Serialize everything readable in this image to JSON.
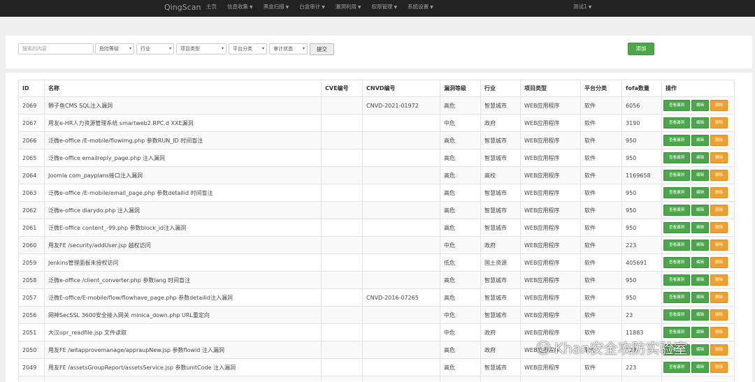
{
  "navbar": {
    "brand": "QingScan",
    "items": [
      {
        "label": "主页",
        "dropdown": false
      },
      {
        "label": "信息收集",
        "dropdown": true
      },
      {
        "label": "黑盒扫描",
        "dropdown": true
      },
      {
        "label": "白盒审计",
        "dropdown": true
      },
      {
        "label": "漏洞利用",
        "dropdown": true
      },
      {
        "label": "权限管理",
        "dropdown": true
      },
      {
        "label": "系统设置",
        "dropdown": true
      }
    ],
    "user": "测试1"
  },
  "filters": {
    "search_placeholder": "搜索的内容",
    "risk_level": "危险等级",
    "industry": "行业",
    "project_type": "项目类型",
    "platform": "平台分类",
    "audit_status": "审计状态",
    "submit_label": "提交",
    "add_label": "添加"
  },
  "table": {
    "headers": [
      "ID",
      "名称",
      "CVE编号",
      "CNVD编号",
      "漏洞等级",
      "行业",
      "项目类型",
      "平台分类",
      "fofa数量",
      "操作"
    ],
    "action_labels": {
      "view": "查看漏洞",
      "edit": "编辑",
      "delete": "删除"
    },
    "rows": [
      {
        "id": "2069",
        "name": "狮子鱼CMS SQL注入漏洞",
        "cve": "",
        "cnvd": "CNVD-2021-01972",
        "level": "高危",
        "industry": "智慧城市",
        "type": "WEB应用程序",
        "platform": "软件",
        "fofa": "6056"
      },
      {
        "id": "2067",
        "name": "用友e-HR人力资源管理系统 smartweb2.RPC.d XXE漏洞",
        "cve": "",
        "cnvd": "",
        "level": "中危",
        "industry": "政府",
        "type": "WEB应用程序",
        "platform": "软件",
        "fofa": "3190"
      },
      {
        "id": "2066",
        "name": "泛微e-office /E-mobile/flowimg.php 参数RUN_ID 时间盲注",
        "cve": "",
        "cnvd": "",
        "level": "高危",
        "industry": "智慧城市",
        "type": "WEB应用程序",
        "platform": "软件",
        "fofa": "950"
      },
      {
        "id": "2065",
        "name": "泛微e-office emailreply_page.php 注入漏洞",
        "cve": "",
        "cnvd": "",
        "level": "高危",
        "industry": "智慧城市",
        "type": "WEB应用程序",
        "platform": "软件",
        "fofa": "950"
      },
      {
        "id": "2064",
        "name": "Joomla com_payplans接口注入漏洞",
        "cve": "",
        "cnvd": "",
        "level": "高危",
        "industry": "高校",
        "type": "WEB应用程序",
        "platform": "软件",
        "fofa": "1169658"
      },
      {
        "id": "2063",
        "name": "泛微e-office /E-mobile/email_page.php 参数detailid 时间盲注",
        "cve": "",
        "cnvd": "",
        "level": "高危",
        "industry": "智慧城市",
        "type": "WEB应用程序",
        "platform": "软件",
        "fofa": "950"
      },
      {
        "id": "2062",
        "name": "泛微e-office diarydo.php 注入漏洞",
        "cve": "",
        "cnvd": "",
        "level": "高危",
        "industry": "智慧城市",
        "type": "WEB应用程序",
        "platform": "软件",
        "fofa": "950"
      },
      {
        "id": "2061",
        "name": "泛微E-office content_-99.php 参数block_id注入漏洞",
        "cve": "",
        "cnvd": "",
        "level": "高危",
        "industry": "智慧城市",
        "type": "WEB应用程序",
        "platform": "软件",
        "fofa": "950"
      },
      {
        "id": "2060",
        "name": "用友FE /security/addUser.jsp 越权访问",
        "cve": "",
        "cnvd": "",
        "level": "中危",
        "industry": "政府",
        "type": "WEB应用程序",
        "platform": "软件",
        "fofa": "223"
      },
      {
        "id": "2059",
        "name": "Jenkins管理面板未授权访问",
        "cve": "",
        "cnvd": "",
        "level": "低危",
        "industry": "国土资源",
        "type": "WEB应用程序",
        "platform": "软件",
        "fofa": "405691"
      },
      {
        "id": "2058",
        "name": "泛微e-office /client_converter.php 参数lang 时间盲注",
        "cve": "",
        "cnvd": "",
        "level": "高危",
        "industry": "智慧城市",
        "type": "WEB应用程序",
        "platform": "软件",
        "fofa": "950"
      },
      {
        "id": "2057",
        "name": "泛微E-office/E-mobile/flow/flowhave_page.php 参数detailid注入漏洞",
        "cve": "",
        "cnvd": "CNVD-2016-07265",
        "level": "高危",
        "industry": "智慧城市",
        "type": "WEB应用程序",
        "platform": "软件",
        "fofa": "950"
      },
      {
        "id": "2056",
        "name": "网神SecSSL 3600安全接入网关 minica_down.php URL重定向",
        "cve": "",
        "cnvd": "",
        "level": "中危",
        "industry": "智慧城市",
        "type": "WEB应用程序",
        "platform": "软件",
        "fofa": "23"
      },
      {
        "id": "2051",
        "name": "大汉opr_readfile.jsp 文件读取",
        "cve": "",
        "cnvd": "",
        "level": "中危",
        "industry": "政府",
        "type": "WEB应用程序",
        "platform": "软件",
        "fofa": "11883"
      },
      {
        "id": "2050",
        "name": "用友FE /witapprovemanage/appraupNew.jsp 参数flowid 注入漏洞",
        "cve": "",
        "cnvd": "",
        "level": "高危",
        "industry": "政府",
        "type": "WEB应用程序",
        "platform": "软件",
        "fofa": "223"
      },
      {
        "id": "2049",
        "name": "用友FE /assetsGroupReport/assetsService.jsp 参数unitCode 注入漏洞",
        "cve": "",
        "cnvd": "",
        "level": "高危",
        "industry": "智慧城市",
        "type": "WEB应用程序",
        "platform": "软件",
        "fofa": "223"
      },
      {
        "id": "",
        "name": "",
        "cve": "",
        "cnvd": "",
        "level": "",
        "industry": "",
        "type": "",
        "platform": "",
        "fofa": ""
      }
    ]
  },
  "watermark": {
    "text": "Khan安全攻防实验室",
    "icon": "wechat-icon"
  },
  "colors": {
    "navbar": "#222222",
    "success": "#4aa84a",
    "warning": "#f0a030",
    "page_bg": "#efefef"
  }
}
